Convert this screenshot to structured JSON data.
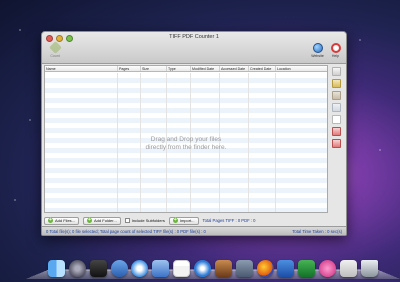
{
  "window": {
    "title": "TIFF PDF Counter 1"
  },
  "toolbar": {
    "left_button_label": "Count",
    "website_label": "Website",
    "help_label": "Help"
  },
  "table": {
    "columns": [
      "Name",
      "Pages",
      "Size",
      "Type",
      "Modified Date",
      "Accessed Date",
      "Created Date",
      "Location"
    ],
    "drop_hint_line1": "Drag  and  Drop  your  files",
    "drop_hint_line2": "directly from the finder here."
  },
  "bottom_bar": {
    "add_files_label": "Add Files...",
    "add_folder_label": "Add Folder...",
    "include_subfolders_label": "Include Subfolders",
    "import_label": "Import...",
    "total_pages_text": "Total Pages TIFF : 0 PDF : 0"
  },
  "status_bar": {
    "left_text": "0 Total file(s); 0 file selected; Total page count of selected TIFF file(s) : 0 PDF file(s) : 0",
    "right_text": "Total Time Taken : 0 sec(s)"
  },
  "dock": {
    "icons": [
      "finder-icon",
      "launchpad-icon",
      "dashboard-icon",
      "mission-control-icon",
      "safari-icon",
      "mail-icon",
      "calendar-icon",
      "itunes-icon",
      "iphoto-icon",
      "utilities-icon",
      "firefox-icon",
      "word-icon",
      "excel-icon",
      "app-icon",
      "tiff-pdf-counter-icon",
      "trash-icon"
    ]
  }
}
